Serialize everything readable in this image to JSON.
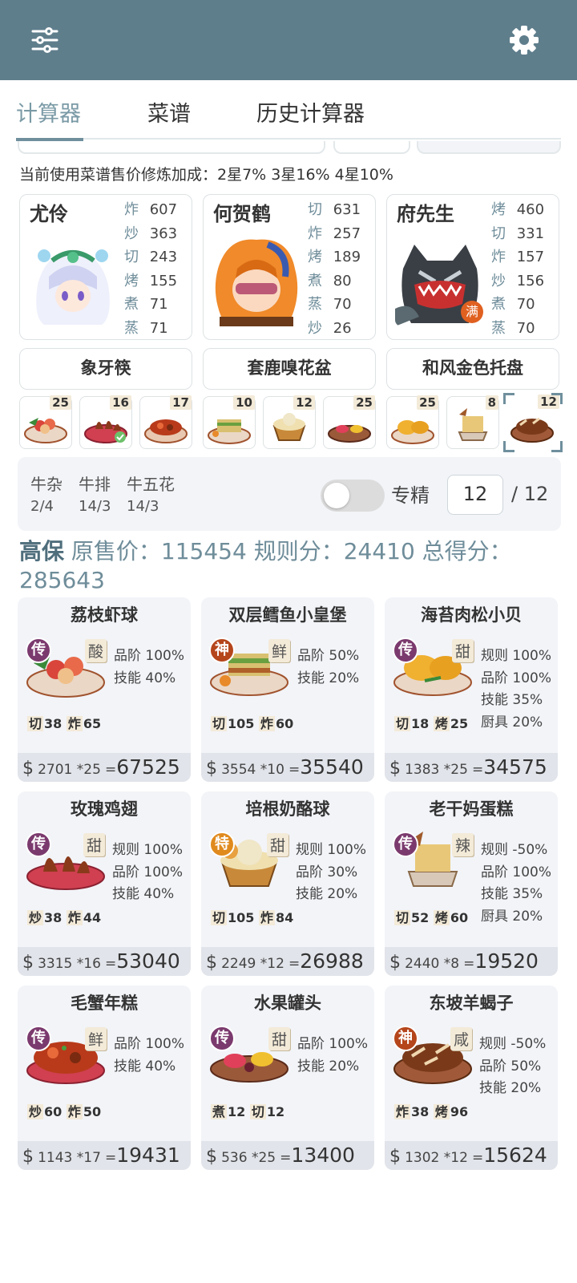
{
  "tabs": [
    "计算器",
    "菜谱",
    "历史计算器"
  ],
  "bonus_text": "当前使用菜谱售价修炼加成：2星7% 3星16% 4星10%",
  "chefs": [
    {
      "name": "尤伶",
      "skills": [
        [
          "炸",
          "607"
        ],
        [
          "炒",
          "363"
        ],
        [
          "切",
          "243"
        ],
        [
          "烤",
          "155"
        ],
        [
          "煮",
          "71"
        ],
        [
          "蒸",
          "71"
        ]
      ]
    },
    {
      "name": "何贺鹤",
      "skills": [
        [
          "切",
          "631"
        ],
        [
          "炸",
          "257"
        ],
        [
          "烤",
          "189"
        ],
        [
          "煮",
          "80"
        ],
        [
          "蒸",
          "70"
        ],
        [
          "炒",
          "26"
        ]
      ]
    },
    {
      "name": "府先生",
      "skills": [
        [
          "烤",
          "460"
        ],
        [
          "切",
          "331"
        ],
        [
          "炸",
          "157"
        ],
        [
          "炒",
          "156"
        ],
        [
          "煮",
          "70"
        ],
        [
          "蒸",
          "70"
        ]
      ],
      "badge": "满"
    }
  ],
  "tools": [
    "象牙筷",
    "套鹿嗅花盆",
    "和风金色托盘"
  ],
  "recipe_counts": [
    "25",
    "16",
    "17",
    "10",
    "12",
    "25",
    "25",
    "8",
    "12"
  ],
  "ingredients": [
    {
      "name": "牛杂",
      "count": "2/4"
    },
    {
      "name": "牛排",
      "count": "14/3"
    },
    {
      "name": "牛五花",
      "count": "14/3"
    }
  ],
  "special": {
    "label": "专精",
    "value": "12",
    "max": "/ 12"
  },
  "summary": {
    "level": "高保",
    "text": " 原售价：115454 规则分：24410 总得分：285643"
  },
  "dishes": [
    {
      "name": "荔枝虾球",
      "badge": "传",
      "tag": "酸",
      "attrs": [
        "品阶 100%",
        "技能 40%"
      ],
      "cs": [
        [
          "切",
          "38"
        ],
        [
          "炸",
          "65"
        ]
      ],
      "price": "2701",
      "mult": "*25",
      "total": "67525"
    },
    {
      "name": "双层鳕鱼小皇堡",
      "badge": "神",
      "tag": "鲜",
      "attrs": [
        "品阶 50%",
        "技能 20%"
      ],
      "cs": [
        [
          "切",
          "105"
        ],
        [
          "炸",
          "60"
        ]
      ],
      "price": "3554",
      "mult": "*10",
      "total": "35540"
    },
    {
      "name": "海苔肉松小贝",
      "badge": "传",
      "tag": "甜",
      "attrs": [
        "规则 100%",
        "品阶 100%",
        "技能 35%",
        "厨具 20%"
      ],
      "cs": [
        [
          "切",
          "18"
        ],
        [
          "烤",
          "25"
        ]
      ],
      "price": "1383",
      "mult": "*25",
      "total": "34575"
    },
    {
      "name": "玫瑰鸡翅",
      "badge": "传",
      "tag": "甜",
      "attrs": [
        "规则 100%",
        "品阶 100%",
        "技能 40%"
      ],
      "cs": [
        [
          "炒",
          "38"
        ],
        [
          "炸",
          "44"
        ]
      ],
      "price": "3315",
      "mult": "*16",
      "total": "53040"
    },
    {
      "name": "培根奶酪球",
      "badge": "特",
      "tag": "甜",
      "attrs": [
        "规则 100%",
        "品阶 30%",
        "技能 20%"
      ],
      "cs": [
        [
          "切",
          "105"
        ],
        [
          "炸",
          "84"
        ]
      ],
      "price": "2249",
      "mult": "*12",
      "total": "26988"
    },
    {
      "name": "老干妈蛋糕",
      "badge": "传",
      "tag": "辣",
      "attrs": [
        "规则 -50%",
        "品阶 100%",
        "技能 35%",
        "厨具 20%"
      ],
      "cs": [
        [
          "切",
          "52"
        ],
        [
          "烤",
          "60"
        ]
      ],
      "price": "2440",
      "mult": "*8",
      "total": "19520"
    },
    {
      "name": "毛蟹年糕",
      "badge": "传",
      "tag": "鲜",
      "attrs": [
        "品阶 100%",
        "技能 40%"
      ],
      "cs": [
        [
          "炒",
          "60"
        ],
        [
          "炸",
          "50"
        ]
      ],
      "price": "1143",
      "mult": "*17",
      "total": "19431"
    },
    {
      "name": "水果罐头",
      "badge": "传",
      "tag": "甜",
      "attrs": [
        "品阶 100%",
        "技能 20%"
      ],
      "cs": [
        [
          "煮",
          "12"
        ],
        [
          "切",
          "12"
        ]
      ],
      "price": "536",
      "mult": "*25",
      "total": "13400"
    },
    {
      "name": "东坡羊蝎子",
      "badge": "神",
      "tag": "咸",
      "attrs": [
        "规则 -50%",
        "品阶 50%",
        "技能 20%"
      ],
      "cs": [
        [
          "炸",
          "38"
        ],
        [
          "烤",
          "96"
        ]
      ],
      "price": "1302",
      "mult": "*12",
      "total": "15624"
    }
  ],
  "colors": {
    "appbar": "#5f7e8c",
    "accent": "#6f8f9d",
    "badge_chuan": "#7b3a6e",
    "badge_shen": "#b5451b",
    "badge_te": "#e08a1e"
  }
}
